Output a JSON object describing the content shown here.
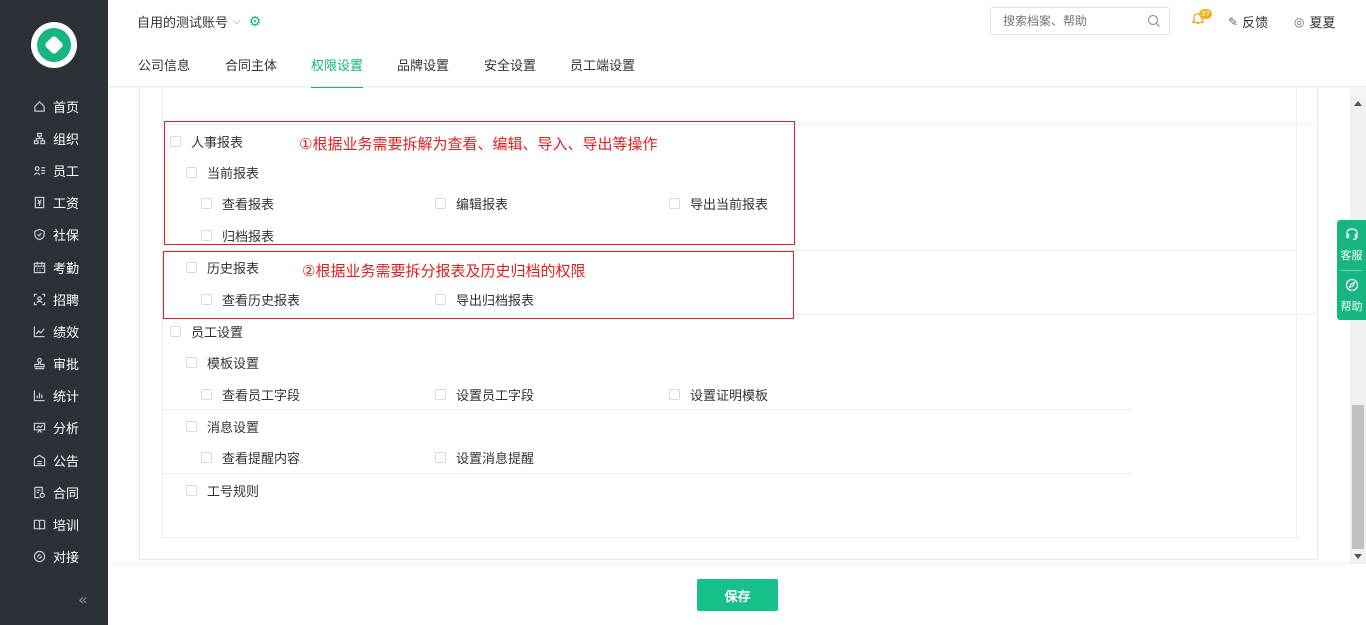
{
  "sidebar": {
    "items": [
      {
        "label": "首页",
        "icon": "home-icon"
      },
      {
        "label": "组织",
        "icon": "org-icon"
      },
      {
        "label": "员工",
        "icon": "employee-icon"
      },
      {
        "label": "工资",
        "icon": "salary-icon"
      },
      {
        "label": "社保",
        "icon": "shield-icon"
      },
      {
        "label": "考勤",
        "icon": "calendar-icon"
      },
      {
        "label": "招聘",
        "icon": "recruit-icon"
      },
      {
        "label": "绩效",
        "icon": "chart-line-icon"
      },
      {
        "label": "审批",
        "icon": "stamp-icon"
      },
      {
        "label": "统计",
        "icon": "bar-chart-icon"
      },
      {
        "label": "分析",
        "icon": "analysis-icon"
      },
      {
        "label": "公告",
        "icon": "notice-icon"
      },
      {
        "label": "合同",
        "icon": "contract-icon"
      },
      {
        "label": "培训",
        "icon": "book-icon"
      },
      {
        "label": "对接",
        "icon": "link-icon"
      }
    ]
  },
  "header": {
    "account": "自用的测试账号",
    "search_placeholder": "搜索档案、帮助",
    "notification_count": "37",
    "feedback": "反馈",
    "user": "夏夏"
  },
  "tabs": [
    "公司信息",
    "合同主体",
    "权限设置",
    "品牌设置",
    "安全设置",
    "员工端设置"
  ],
  "active_tab": "权限设置",
  "permissions": {
    "hr_report": "人事报表",
    "current_report": "当前报表",
    "view_report": "查看报表",
    "edit_report": "编辑报表",
    "export_current": "导出当前报表",
    "archive_report": "归档报表",
    "history_report": "历史报表",
    "view_history": "查看历史报表",
    "export_archive": "导出归档报表",
    "employee_settings": "员工设置",
    "template_settings": "模板设置",
    "view_fields": "查看员工字段",
    "set_fields": "设置员工字段",
    "set_certificate": "设置证明模板",
    "message_settings": "消息设置",
    "view_reminder": "查看提醒内容",
    "set_reminder": "设置消息提醒",
    "job_number_rule": "工号规则"
  },
  "annotations": {
    "a1": "①根据业务需要拆解为查看、编辑、导入、导出等操作",
    "a2": "②根据业务需要拆分报表及历史归档的权限",
    "color": "#e02020"
  },
  "float_help": {
    "service": "客服",
    "help": "帮助"
  },
  "footer": {
    "save": "保存"
  },
  "colors": {
    "accent": "#16b582",
    "sidebar_bg": "#2c3137"
  }
}
